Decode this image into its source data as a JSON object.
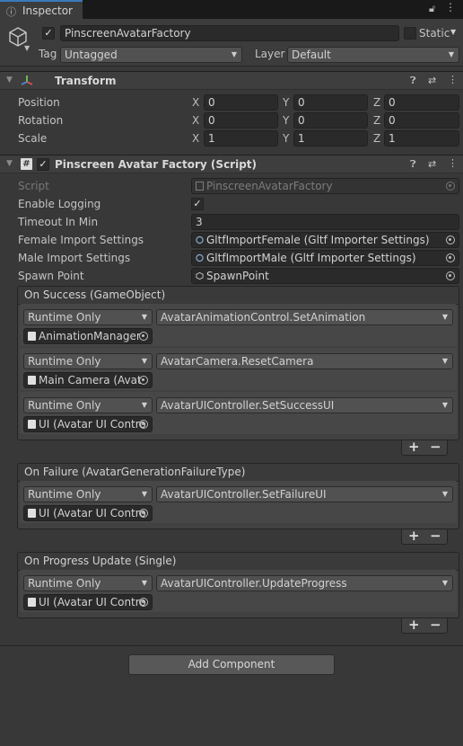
{
  "tab": {
    "label": "Inspector",
    "info_icon": "info-icon",
    "lock_icon": "lock-icon",
    "more_icon": "kebab-menu-icon"
  },
  "gameobject": {
    "name": "PinscreenAvatarFactory",
    "active": true,
    "static_label": "Static",
    "tag_label": "Tag",
    "tag_value": "Untagged",
    "layer_label": "Layer",
    "layer_value": "Default"
  },
  "transform": {
    "title": "Transform",
    "rows": [
      {
        "label": "Position",
        "x": "0",
        "y": "0",
        "z": "0"
      },
      {
        "label": "Rotation",
        "x": "0",
        "y": "0",
        "z": "0"
      },
      {
        "label": "Scale",
        "x": "1",
        "y": "1",
        "z": "1"
      }
    ],
    "axis": {
      "x": "X",
      "y": "Y",
      "z": "Z"
    }
  },
  "script_component": {
    "title": "Pinscreen Avatar Factory (Script)",
    "enabled": true,
    "fields": {
      "script_label": "Script",
      "script_value": "PinscreenAvatarFactory",
      "logging_label": "Enable Logging",
      "logging_value": true,
      "timeout_label": "Timeout In Min",
      "timeout_value": "3",
      "female_label": "Female Import Settings",
      "female_value": "GltfImportFemale (Gltf Importer Settings)",
      "male_label": "Male Import Settings",
      "male_value": "GltfImportMale (Gltf Importer Settings)",
      "spawn_label": "Spawn Point",
      "spawn_value": "SpawnPoint"
    }
  },
  "events": {
    "success": {
      "title": "On Success (GameObject)",
      "entries": [
        {
          "mode": "Runtime Only",
          "function": "AvatarAnimationControl.SetAnimation",
          "target": "AnimationManager"
        },
        {
          "mode": "Runtime Only",
          "function": "AvatarCamera.ResetCamera",
          "target": "Main Camera (Avat"
        },
        {
          "mode": "Runtime Only",
          "function": "AvatarUIController.SetSuccessUI",
          "target": "UI (Avatar UI Contro"
        }
      ]
    },
    "failure": {
      "title": "On Failure (AvatarGenerationFailureType)",
      "entries": [
        {
          "mode": "Runtime Only",
          "function": "AvatarUIController.SetFailureUI",
          "target": "UI (Avatar UI Contro"
        }
      ]
    },
    "progress": {
      "title": "On Progress Update (Single)",
      "entries": [
        {
          "mode": "Runtime Only",
          "function": "AvatarUIController.UpdateProgress",
          "target": "UI (Avatar UI Contro"
        }
      ]
    },
    "plus": "+",
    "minus": "−"
  },
  "add_component": "Add Component",
  "colors": {
    "accent": "#3a79bb",
    "panel": "#383838",
    "field": "#2a2a2a"
  }
}
